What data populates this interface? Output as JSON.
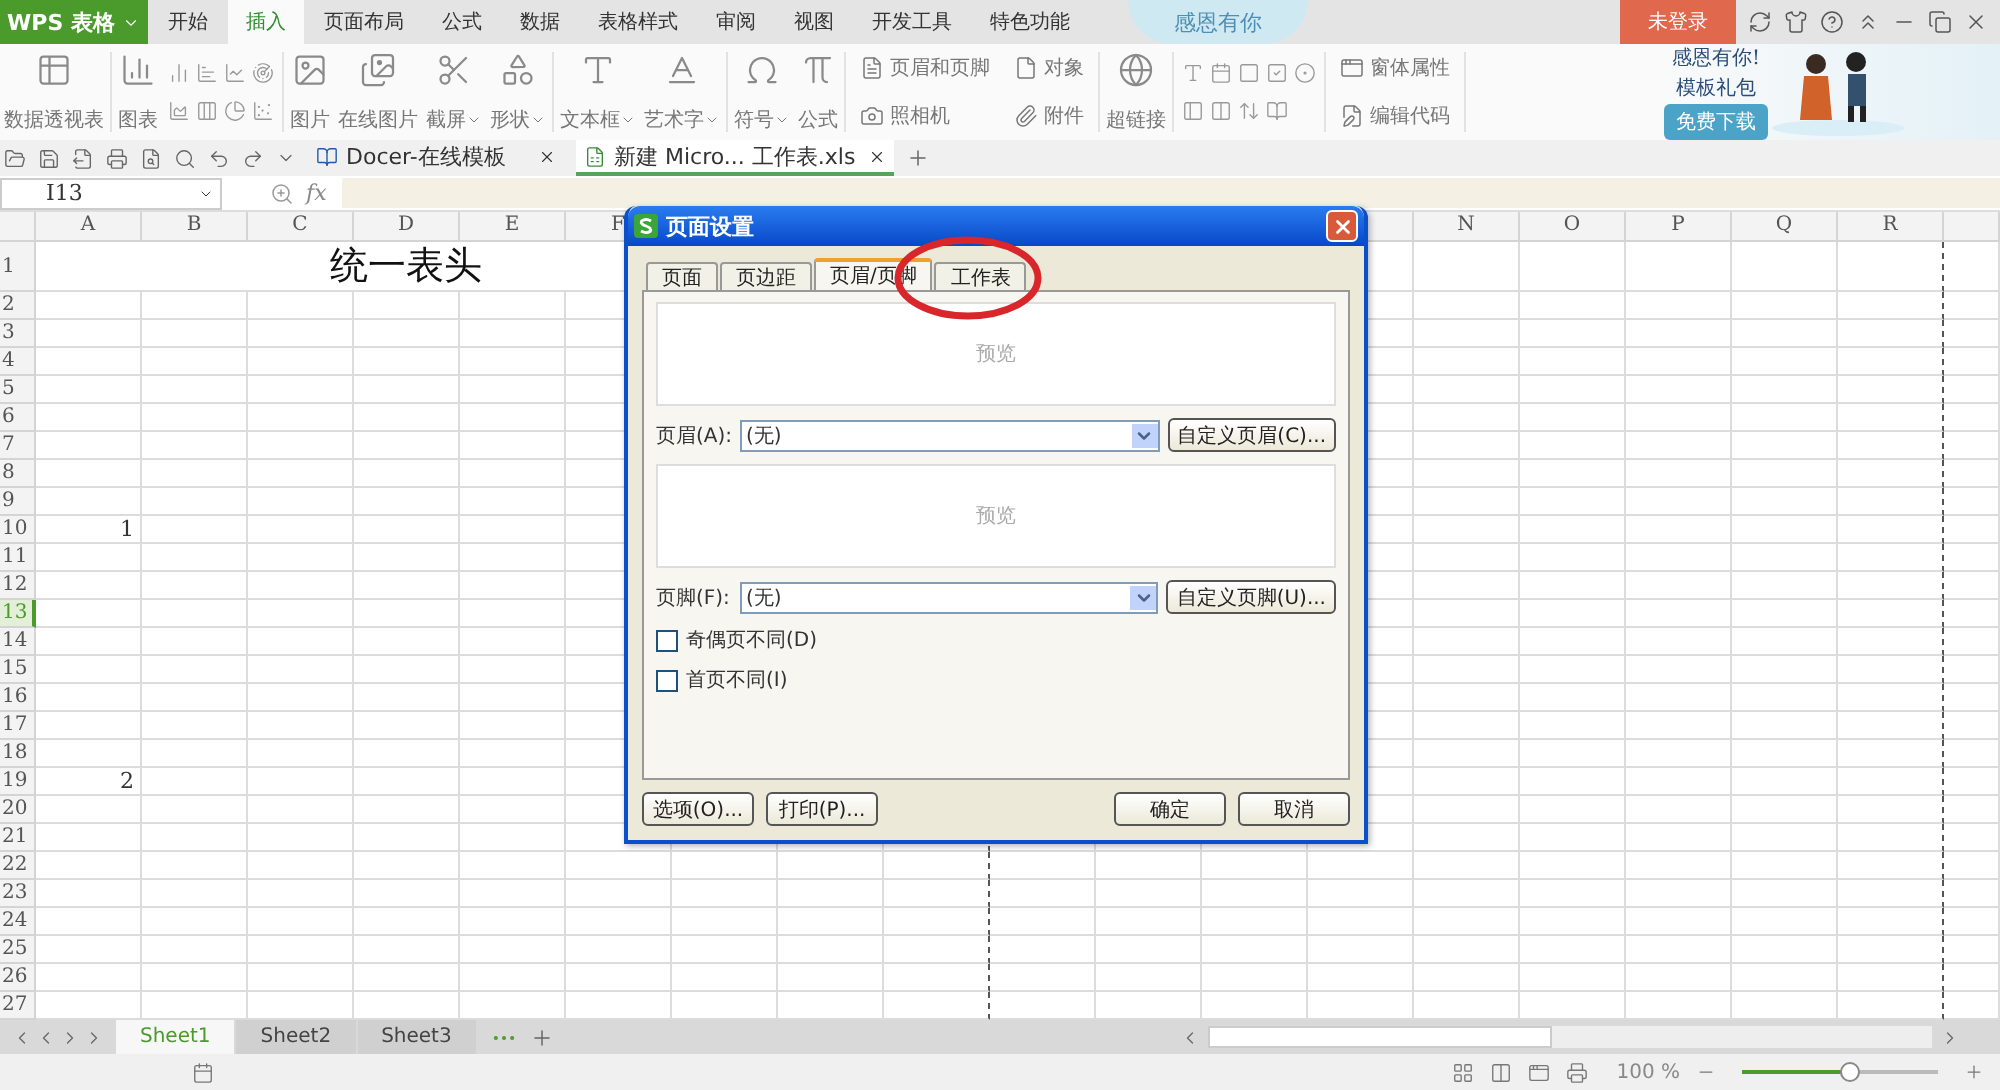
{
  "app_button": {
    "label": "WPS 表格"
  },
  "menu_tabs": [
    {
      "label": "开始",
      "selected": false
    },
    {
      "label": "插入",
      "selected": true
    },
    {
      "label": "页面布局",
      "selected": false
    },
    {
      "label": "公式",
      "selected": false
    },
    {
      "label": "数据",
      "selected": false
    },
    {
      "label": "表格样式",
      "selected": false
    },
    {
      "label": "审阅",
      "selected": false
    },
    {
      "label": "视图",
      "selected": false
    },
    {
      "label": "开发工具",
      "selected": false
    },
    {
      "label": "特色功能",
      "selected": false
    }
  ],
  "banner": {
    "label": "感恩有你"
  },
  "login_button": {
    "label": "未登录"
  },
  "ribbon": [
    {
      "kind": "big",
      "label": "数据透视表",
      "dropdown": false
    },
    {
      "kind": "big",
      "label": "图表",
      "dropdown": false
    },
    {
      "kind": "chart_grid"
    },
    {
      "kind": "big",
      "label": "图片",
      "dropdown": false
    },
    {
      "kind": "big",
      "label": "在线图片",
      "dropdown": false
    },
    {
      "kind": "big",
      "label": "截屏",
      "dropdown": true
    },
    {
      "kind": "big",
      "label": "形状",
      "dropdown": true
    },
    {
      "kind": "big",
      "label": "文本框",
      "dropdown": true
    },
    {
      "kind": "big",
      "label": "艺术字",
      "dropdown": true
    },
    {
      "kind": "big",
      "label": "符号",
      "dropdown": true
    },
    {
      "kind": "big",
      "label": "公式",
      "dropdown": false
    },
    {
      "kind": "pair",
      "labels": [
        "页眉和页脚",
        "照相机"
      ]
    },
    {
      "kind": "pair",
      "labels": [
        "对象",
        "附件"
      ]
    },
    {
      "kind": "big",
      "label": "超链接",
      "dropdown": false
    },
    {
      "kind": "control_grid"
    },
    {
      "kind": "pair",
      "labels": [
        "窗体属性",
        "编辑代码"
      ]
    }
  ],
  "ad": {
    "lines": [
      "感恩有你!",
      "模板礼包"
    ],
    "button": "免费下载"
  },
  "doc_tabs": [
    {
      "label": "Docer-在线模板",
      "selected": false
    },
    {
      "label": "新建 Micro... 工作表.xls",
      "selected": true
    }
  ],
  "formula_bar": {
    "cell_ref": "I13",
    "function_label": "fx"
  },
  "sheet": {
    "columns_left": [
      "A",
      "B",
      "C",
      "D",
      "E",
      "F"
    ],
    "columns_right": [
      "N",
      "O",
      "P",
      "Q",
      "R"
    ],
    "title": "统一表头",
    "rows": [
      {
        "label": "1",
        "selected": false
      },
      {
        "label": "2",
        "selected": false
      },
      {
        "label": "3",
        "selected": false
      },
      {
        "label": "4",
        "selected": false
      },
      {
        "label": "5",
        "selected": false
      },
      {
        "label": "6",
        "selected": false
      },
      {
        "label": "7",
        "selected": false
      },
      {
        "label": "8",
        "selected": false
      },
      {
        "label": "9",
        "selected": false
      },
      {
        "label": "10",
        "selected": false,
        "value": "1"
      },
      {
        "label": "11",
        "selected": false
      },
      {
        "label": "12",
        "selected": false
      },
      {
        "label": "13",
        "selected": true
      },
      {
        "label": "14",
        "selected": false
      },
      {
        "label": "15",
        "selected": false
      },
      {
        "label": "16",
        "selected": false
      },
      {
        "label": "17",
        "selected": false
      },
      {
        "label": "18",
        "selected": false
      },
      {
        "label": "19",
        "selected": false,
        "value": "2"
      },
      {
        "label": "20",
        "selected": false
      },
      {
        "label": "21",
        "selected": false
      },
      {
        "label": "22",
        "selected": false
      },
      {
        "label": "23",
        "selected": false
      },
      {
        "label": "24",
        "selected": false
      },
      {
        "label": "25",
        "selected": false
      },
      {
        "label": "26",
        "selected": false
      },
      {
        "label": "27",
        "selected": false
      }
    ]
  },
  "sheet_tabs": [
    {
      "label": "Sheet1",
      "selected": true
    },
    {
      "label": "Sheet2",
      "selected": false
    },
    {
      "label": "Sheet3",
      "selected": false
    }
  ],
  "status_bar": {
    "zoom": "100 %",
    "level": 0.55
  },
  "dialog": {
    "title": "页面设置",
    "tabs": [
      {
        "label": "页面",
        "selected": false
      },
      {
        "label": "页边距",
        "selected": false
      },
      {
        "label": "页眉/页脚",
        "selected": true
      },
      {
        "label": "工作表",
        "selected": false
      }
    ],
    "sections": [
      {
        "preview": "预览",
        "label": "页眉(A):",
        "value": "(无)",
        "button": "自定义页眉(C)..."
      },
      {
        "preview": "预览",
        "label": "页脚(F):",
        "value": "(无)",
        "button": "自定义页脚(U)..."
      }
    ],
    "checkboxes": [
      {
        "label": "奇偶页不同(D)",
        "checked": false
      },
      {
        "label": "首页不同(I)",
        "checked": false
      }
    ],
    "buttons": [
      {
        "label": "选项(O)...",
        "kind": "left"
      },
      {
        "label": "打印(P)...",
        "kind": "left"
      },
      {
        "label": "确定",
        "kind": "right"
      },
      {
        "label": "取消",
        "kind": "right"
      }
    ]
  }
}
